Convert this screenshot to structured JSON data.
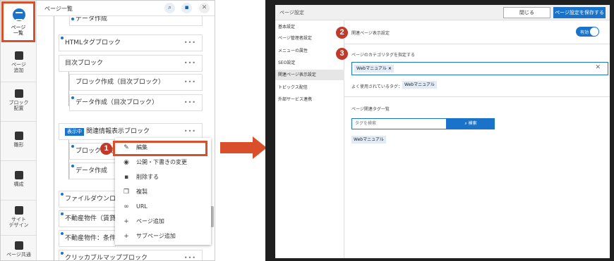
{
  "left_panel": {
    "rail": [
      {
        "label": "ページ\n一覧"
      },
      {
        "label": "ページ\n追加"
      },
      {
        "label": "ブロック\n配置"
      },
      {
        "label": "雛形"
      },
      {
        "label": "構成"
      },
      {
        "label": "サイト\nデザイン"
      },
      {
        "label": "ページ共通"
      }
    ],
    "tree_title": "ページ一覧",
    "nodes": [
      {
        "label": "データ作成"
      },
      {
        "label": "HTMLタグブロック"
      },
      {
        "label": "目次ブロック"
      },
      {
        "label": "ブロック作成（目次ブロック）"
      },
      {
        "label": "データ作成（目次ブロック）"
      },
      {
        "label": "関連情報表示ブロック",
        "badge": "表示中"
      },
      {
        "label": "ブロック作成"
      },
      {
        "label": "データ作成"
      },
      {
        "label": "ファイルダウンロ"
      },
      {
        "label": "不動産物件（賃貸"
      },
      {
        "label": "不動産物件：条件"
      },
      {
        "label": "クリッカブルマップブロック"
      }
    ],
    "context_menu": [
      {
        "label": "編集",
        "icon": "edit-icon",
        "glyph": "✎"
      },
      {
        "label": "公開・下書きの変更",
        "icon": "eye-icon",
        "glyph": "◉"
      },
      {
        "label": "削除する",
        "icon": "trash-icon",
        "glyph": "▪"
      },
      {
        "label": "複製",
        "icon": "copy-icon",
        "glyph": "❐"
      },
      {
        "label": "URL",
        "icon": "link-icon",
        "glyph": "∞"
      },
      {
        "label": "ページ追加",
        "icon": "plus-icon",
        "glyph": "+"
      },
      {
        "label": "サブページ追加",
        "icon": "plus-icon",
        "glyph": "+"
      }
    ]
  },
  "steps": {
    "one": "1",
    "two": "2",
    "three": "3"
  },
  "settings": {
    "title": "ページ設定",
    "close_label": "閉じる",
    "save_label": "ページ設定を保存する",
    "side_items": [
      "基本設定",
      "ページ管理者設定",
      "メニューの属性",
      "SEO設定",
      "関連ページ表示設定",
      "トピックス配信",
      "外部サービス連携"
    ],
    "active_index": 4,
    "related_label": "関連ページ表示設定",
    "toggle_label": "有効",
    "category_label": "ページのカテゴリタグを指定する",
    "selected_tag": "Webマニュアル",
    "frequent_label": "よく使用されているタグ：",
    "frequent_tag": "Webマニュアル",
    "list_label": "ページ関連タグ一覧",
    "search_placeholder": "タグを検索",
    "search_button": "検索",
    "result_tag": "Webマニュアル"
  },
  "colors": {
    "accent": "#1a73c9",
    "highlight": "#d94f2b"
  }
}
